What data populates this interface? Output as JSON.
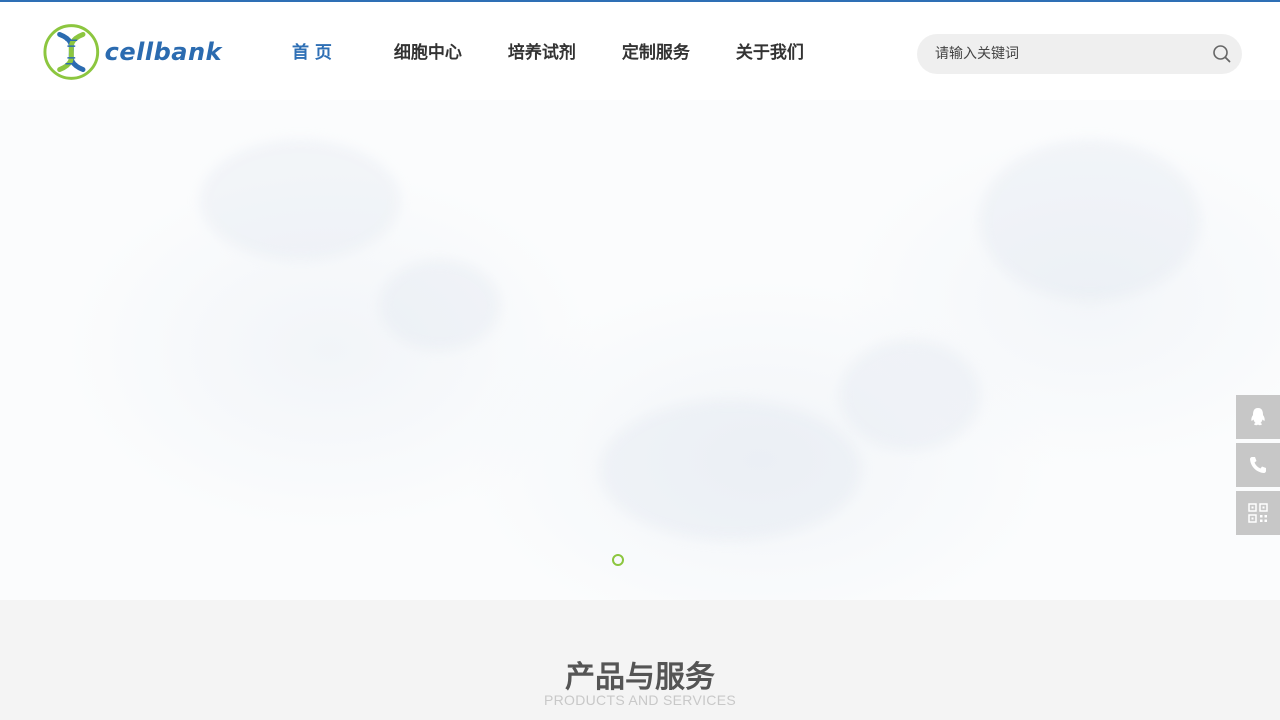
{
  "brand": {
    "logo_text": "cellbank"
  },
  "nav": {
    "items": [
      {
        "label": "首 页",
        "active": true
      },
      {
        "label": "细胞中心"
      },
      {
        "label": "培养试剂"
      },
      {
        "label": "定制服务"
      },
      {
        "label": "关于我们"
      }
    ]
  },
  "search": {
    "placeholder": "请输入关键词",
    "icon": "search-icon"
  },
  "banner": {
    "slides": 1,
    "active_slide": 1
  },
  "side_tools": {
    "items": [
      {
        "icon": "qq-icon"
      },
      {
        "icon": "phone-icon"
      },
      {
        "icon": "qrcode-icon"
      }
    ]
  },
  "products": {
    "title": "产品与服务",
    "subtitle": "PRODUCTS AND SERVICES"
  },
  "colors": {
    "accent": "#2e6fb5",
    "logo_green": "#8cc63f",
    "section_bg": "#f4f4f4",
    "side_btn": "#c7c7c7"
  }
}
